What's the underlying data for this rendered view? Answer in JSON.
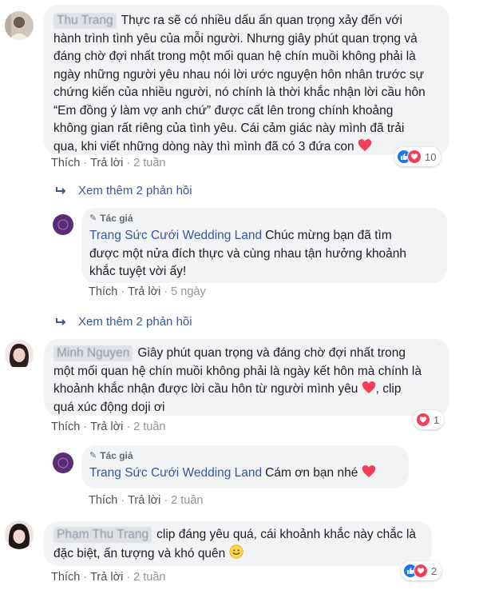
{
  "comments": [
    {
      "name_blurred": "Thu Trang",
      "text": "Thực ra sẽ có nhiều dấu ấn quan trọng xảy đến với\nhành trình tình yêu của mỗi người. Nhưng giây phút quan trọng và\nđáng chờ đợi nhất trong một mối quan hệ chín muồi không phải là\nngày những người yêu nhau nói lời ước nguyện hôn nhân trước sự\nchứng kiến của nhiều người, nó chính là thời khắc nhận lời cầu hôn\n“Em đồng ý làm vợ anh chứ” được cất lên trong chính khoảng\nkhông gian rất riêng của tình yêu. Cái cảm giác này mình đã trải\nqua, khi viết những dòng này thì mình đã có 3 đứa con",
      "like": "Thích",
      "reply": "Trả lời",
      "time": "2 tuần",
      "reaction_count": "10"
    },
    {
      "name_blurred": "Minh Nguyen",
      "text": "Giây phút quan trọng và đáng chờ đợi nhất trong\nmột mối quan hệ chín muồi không phải là ngày kết hôn mà chính là\nkhoảnh khắc nhận được lời cầu hôn từ người mình yêu",
      "text_tail": ", clip\nquá xúc động doji ơi",
      "like": "Thích",
      "reply": "Trả lời",
      "time": "2 tuần",
      "reaction_count": "1"
    },
    {
      "name_blurred": "Phạm Thu Trang",
      "text": "clip đáng yêu quá, cái khoảnh khắc này chắc là\nđặc biệt, ấn tượng và khó quên",
      "like": "Thích",
      "reply": "Trả lời",
      "time": "2 tuần",
      "reaction_count": "2"
    }
  ],
  "replies": [
    {
      "badge": "Tác giả",
      "page_name": "Trang Sức Cưới Wedding Land",
      "text": "Chúc mừng bạn đã tìm\nđược một nửa đích thực và cùng nhau tận hưởng khoảnh\nkhắc tuyệt vời ấy!",
      "like": "Thích",
      "reply": "Trả lời",
      "time": "5 ngày"
    },
    {
      "badge": "Tác giả",
      "page_name": "Trang Sức Cưới Wedding Land",
      "text": "Cám ơn bạn nhé",
      "like": "Thích",
      "reply": "Trả lời",
      "time": "2 tuần"
    }
  ],
  "more_replies": [
    "Xem thêm 2 phản hồi",
    "Xem thêm 2 phản hồi"
  ],
  "separator": "·",
  "colors": {
    "link": "#385898",
    "bubble": "#f2f3f5",
    "like_blue": "#1877f2",
    "love_red": "#f33e58"
  }
}
